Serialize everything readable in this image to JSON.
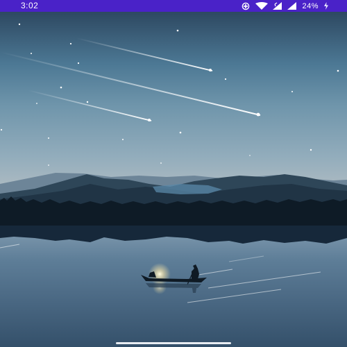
{
  "status_bar": {
    "time": "3:02",
    "battery_percent": "24%",
    "background_color": "#4a22c8",
    "icons": [
      "data-saver-icon",
      "wifi-icon",
      "cell-signal-icon",
      "cell-signal-icon",
      "battery-charging-icon"
    ]
  },
  "wallpaper": {
    "subject": "night-lake-boat-meteor-shower",
    "colors": {
      "sky_top": "#2e4a63",
      "sky_mid": "#5d8aa6",
      "horizon": "#b9c3c9",
      "water": "#44617c"
    }
  },
  "navigation": {
    "gesture_handle": "home-gesture-handle"
  }
}
